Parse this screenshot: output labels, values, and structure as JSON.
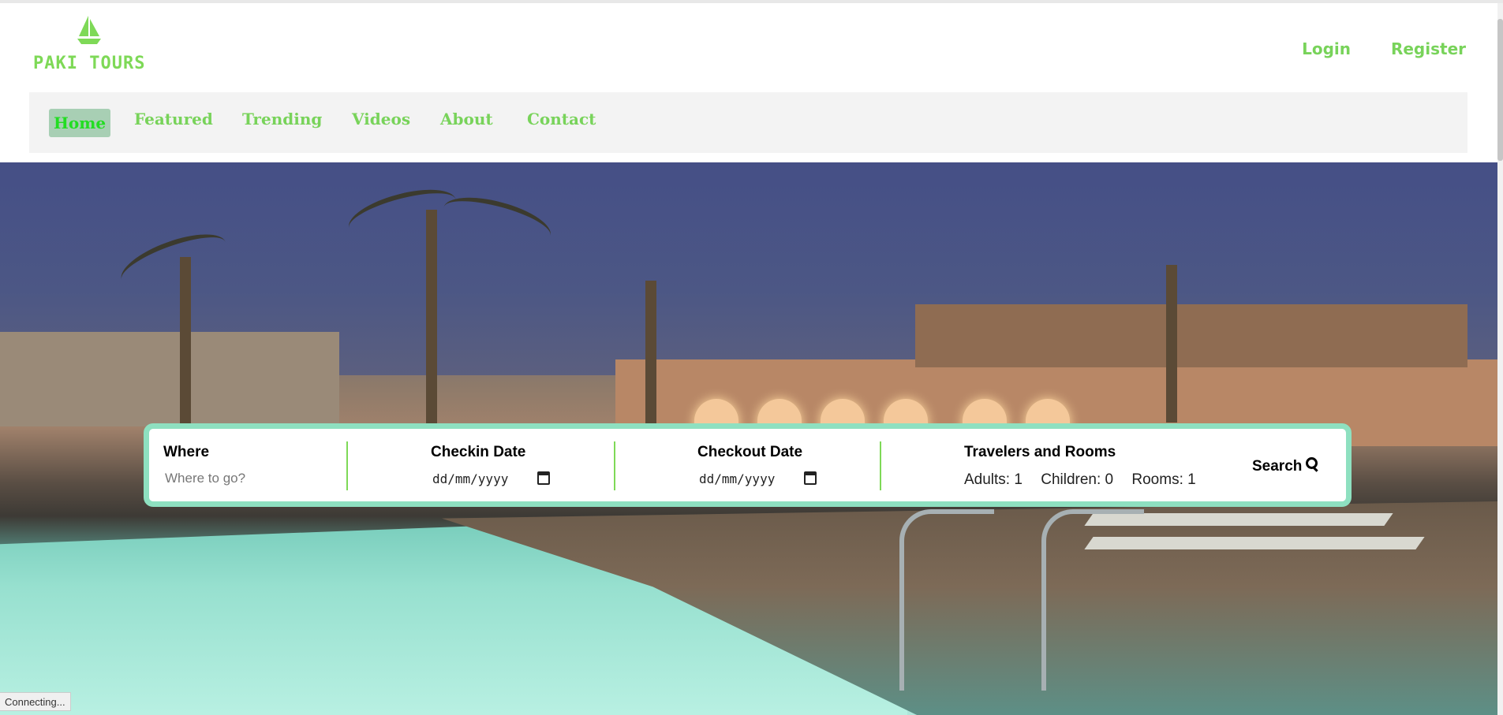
{
  "brand": {
    "name": "PAKI TOURS",
    "logo_icon": "sailboat-icon",
    "color": "#7ed957"
  },
  "auth": {
    "login": "Login",
    "register": "Register"
  },
  "nav": {
    "items": [
      {
        "label": "Home",
        "active": true
      },
      {
        "label": "Featured"
      },
      {
        "label": "Trending"
      },
      {
        "label": "Videos"
      },
      {
        "label": "About"
      },
      {
        "label": "Contact"
      }
    ]
  },
  "search": {
    "where": {
      "label": "Where",
      "placeholder": "Where to go?"
    },
    "checkin": {
      "label": "Checkin Date",
      "value": "dd/mm/yyyy"
    },
    "checkout": {
      "label": "Checkout Date",
      "value": "dd/mm/yyyy"
    },
    "travelers": {
      "label": "Travelers and Rooms",
      "adults": "Adults: 1",
      "children": "Children: 0",
      "rooms": "Rooms: 1"
    },
    "button": "Search",
    "button_icon": "search-icon"
  },
  "status_bar": "Connecting...",
  "colors": {
    "accent": "#78d35a",
    "panel_border": "#8ee0c0",
    "nav_bg": "#f3f3f3",
    "active_nav_bg": "#a8cfb4"
  }
}
